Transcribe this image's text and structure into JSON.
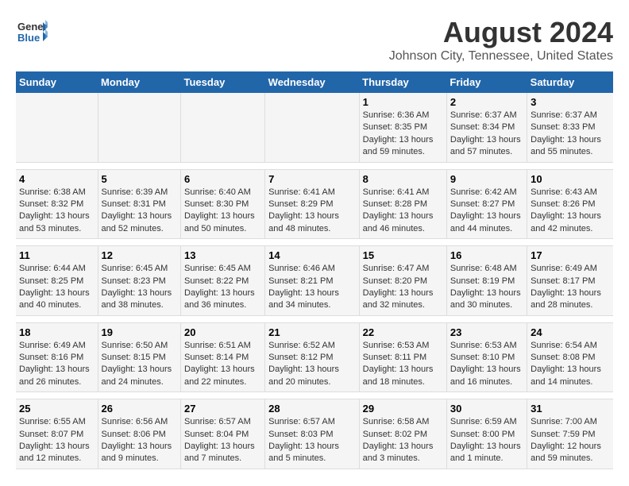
{
  "logo": {
    "general": "General",
    "blue": "Blue"
  },
  "title": "August 2024",
  "subtitle": "Johnson City, Tennessee, United States",
  "days_of_week": [
    "Sunday",
    "Monday",
    "Tuesday",
    "Wednesday",
    "Thursday",
    "Friday",
    "Saturday"
  ],
  "weeks": [
    [
      {
        "day": "",
        "sunrise": "",
        "sunset": "",
        "daylight": ""
      },
      {
        "day": "",
        "sunrise": "",
        "sunset": "",
        "daylight": ""
      },
      {
        "day": "",
        "sunrise": "",
        "sunset": "",
        "daylight": ""
      },
      {
        "day": "",
        "sunrise": "",
        "sunset": "",
        "daylight": ""
      },
      {
        "day": "1",
        "sunrise": "Sunrise: 6:36 AM",
        "sunset": "Sunset: 8:35 PM",
        "daylight": "Daylight: 13 hours and 59 minutes."
      },
      {
        "day": "2",
        "sunrise": "Sunrise: 6:37 AM",
        "sunset": "Sunset: 8:34 PM",
        "daylight": "Daylight: 13 hours and 57 minutes."
      },
      {
        "day": "3",
        "sunrise": "Sunrise: 6:37 AM",
        "sunset": "Sunset: 8:33 PM",
        "daylight": "Daylight: 13 hours and 55 minutes."
      }
    ],
    [
      {
        "day": "4",
        "sunrise": "Sunrise: 6:38 AM",
        "sunset": "Sunset: 8:32 PM",
        "daylight": "Daylight: 13 hours and 53 minutes."
      },
      {
        "day": "5",
        "sunrise": "Sunrise: 6:39 AM",
        "sunset": "Sunset: 8:31 PM",
        "daylight": "Daylight: 13 hours and 52 minutes."
      },
      {
        "day": "6",
        "sunrise": "Sunrise: 6:40 AM",
        "sunset": "Sunset: 8:30 PM",
        "daylight": "Daylight: 13 hours and 50 minutes."
      },
      {
        "day": "7",
        "sunrise": "Sunrise: 6:41 AM",
        "sunset": "Sunset: 8:29 PM",
        "daylight": "Daylight: 13 hours and 48 minutes."
      },
      {
        "day": "8",
        "sunrise": "Sunrise: 6:41 AM",
        "sunset": "Sunset: 8:28 PM",
        "daylight": "Daylight: 13 hours and 46 minutes."
      },
      {
        "day": "9",
        "sunrise": "Sunrise: 6:42 AM",
        "sunset": "Sunset: 8:27 PM",
        "daylight": "Daylight: 13 hours and 44 minutes."
      },
      {
        "day": "10",
        "sunrise": "Sunrise: 6:43 AM",
        "sunset": "Sunset: 8:26 PM",
        "daylight": "Daylight: 13 hours and 42 minutes."
      }
    ],
    [
      {
        "day": "11",
        "sunrise": "Sunrise: 6:44 AM",
        "sunset": "Sunset: 8:25 PM",
        "daylight": "Daylight: 13 hours and 40 minutes."
      },
      {
        "day": "12",
        "sunrise": "Sunrise: 6:45 AM",
        "sunset": "Sunset: 8:23 PM",
        "daylight": "Daylight: 13 hours and 38 minutes."
      },
      {
        "day": "13",
        "sunrise": "Sunrise: 6:45 AM",
        "sunset": "Sunset: 8:22 PM",
        "daylight": "Daylight: 13 hours and 36 minutes."
      },
      {
        "day": "14",
        "sunrise": "Sunrise: 6:46 AM",
        "sunset": "Sunset: 8:21 PM",
        "daylight": "Daylight: 13 hours and 34 minutes."
      },
      {
        "day": "15",
        "sunrise": "Sunrise: 6:47 AM",
        "sunset": "Sunset: 8:20 PM",
        "daylight": "Daylight: 13 hours and 32 minutes."
      },
      {
        "day": "16",
        "sunrise": "Sunrise: 6:48 AM",
        "sunset": "Sunset: 8:19 PM",
        "daylight": "Daylight: 13 hours and 30 minutes."
      },
      {
        "day": "17",
        "sunrise": "Sunrise: 6:49 AM",
        "sunset": "Sunset: 8:17 PM",
        "daylight": "Daylight: 13 hours and 28 minutes."
      }
    ],
    [
      {
        "day": "18",
        "sunrise": "Sunrise: 6:49 AM",
        "sunset": "Sunset: 8:16 PM",
        "daylight": "Daylight: 13 hours and 26 minutes."
      },
      {
        "day": "19",
        "sunrise": "Sunrise: 6:50 AM",
        "sunset": "Sunset: 8:15 PM",
        "daylight": "Daylight: 13 hours and 24 minutes."
      },
      {
        "day": "20",
        "sunrise": "Sunrise: 6:51 AM",
        "sunset": "Sunset: 8:14 PM",
        "daylight": "Daylight: 13 hours and 22 minutes."
      },
      {
        "day": "21",
        "sunrise": "Sunrise: 6:52 AM",
        "sunset": "Sunset: 8:12 PM",
        "daylight": "Daylight: 13 hours and 20 minutes."
      },
      {
        "day": "22",
        "sunrise": "Sunrise: 6:53 AM",
        "sunset": "Sunset: 8:11 PM",
        "daylight": "Daylight: 13 hours and 18 minutes."
      },
      {
        "day": "23",
        "sunrise": "Sunrise: 6:53 AM",
        "sunset": "Sunset: 8:10 PM",
        "daylight": "Daylight: 13 hours and 16 minutes."
      },
      {
        "day": "24",
        "sunrise": "Sunrise: 6:54 AM",
        "sunset": "Sunset: 8:08 PM",
        "daylight": "Daylight: 13 hours and 14 minutes."
      }
    ],
    [
      {
        "day": "25",
        "sunrise": "Sunrise: 6:55 AM",
        "sunset": "Sunset: 8:07 PM",
        "daylight": "Daylight: 13 hours and 12 minutes."
      },
      {
        "day": "26",
        "sunrise": "Sunrise: 6:56 AM",
        "sunset": "Sunset: 8:06 PM",
        "daylight": "Daylight: 13 hours and 9 minutes."
      },
      {
        "day": "27",
        "sunrise": "Sunrise: 6:57 AM",
        "sunset": "Sunset: 8:04 PM",
        "daylight": "Daylight: 13 hours and 7 minutes."
      },
      {
        "day": "28",
        "sunrise": "Sunrise: 6:57 AM",
        "sunset": "Sunset: 8:03 PM",
        "daylight": "Daylight: 13 hours and 5 minutes."
      },
      {
        "day": "29",
        "sunrise": "Sunrise: 6:58 AM",
        "sunset": "Sunset: 8:02 PM",
        "daylight": "Daylight: 13 hours and 3 minutes."
      },
      {
        "day": "30",
        "sunrise": "Sunrise: 6:59 AM",
        "sunset": "Sunset: 8:00 PM",
        "daylight": "Daylight: 13 hours and 1 minute."
      },
      {
        "day": "31",
        "sunrise": "Sunrise: 7:00 AM",
        "sunset": "Sunset: 7:59 PM",
        "daylight": "Daylight: 12 hours and 59 minutes."
      }
    ]
  ]
}
